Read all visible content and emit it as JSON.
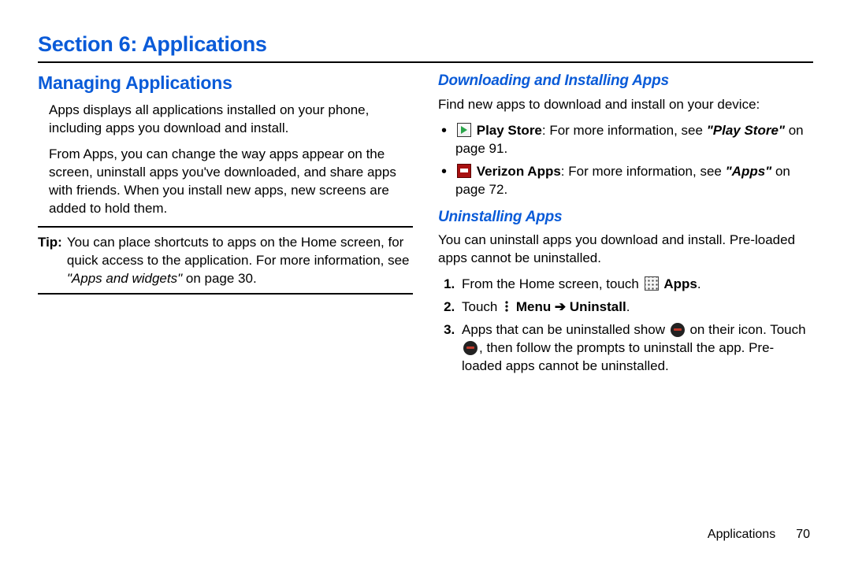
{
  "section_title": "Section 6: Applications",
  "left": {
    "heading": "Managing Applications",
    "para1": "Apps displays all applications installed on your phone, including apps you download and install.",
    "para2": "From Apps, you can change the way apps appear on the screen, uninstall apps you've downloaded, and share apps with friends. When you install new apps, new screens are added to hold them.",
    "tip_label": "Tip:",
    "tip_body_a": "You can place shortcuts to apps on the Home screen, for quick access to the application. For more information, see ",
    "tip_ref": "\"Apps and widgets\"",
    "tip_body_b": " on page 30."
  },
  "right": {
    "h_downloading": "Downloading and Installing Apps",
    "downloading_intro": "Find new apps to download and install on your device:",
    "bullet1_bold": "Play Store",
    "bullet1_a": ": For more information, see ",
    "bullet1_ref": "\"Play Store\"",
    "bullet1_b": " on page 91.",
    "bullet2_bold": "Verizon Apps",
    "bullet2_a": ": For more information, see ",
    "bullet2_ref": "\"Apps\"",
    "bullet2_b": " on page 72.",
    "h_uninstall": "Uninstalling Apps",
    "uninstall_intro": "You can uninstall apps you download and install. Pre-loaded apps cannot be uninstalled.",
    "step1_a": "From the Home screen, touch ",
    "step1_bold": "Apps",
    "step1_b": ".",
    "step2_a": "Touch ",
    "step2_bold": "Menu ➔ Uninstall",
    "step2_b": ".",
    "step3_a": "Apps that can be uninstalled show ",
    "step3_b": " on their icon. Touch ",
    "step3_c": ", then follow the prompts to uninstall the app. Pre-loaded apps cannot be uninstalled."
  },
  "footer": {
    "section": "Applications",
    "page": "70"
  }
}
